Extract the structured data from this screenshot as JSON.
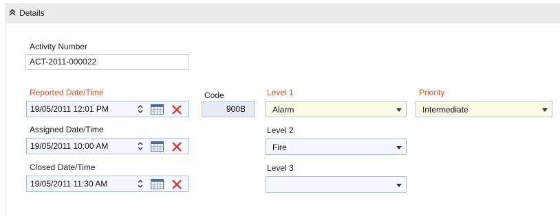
{
  "section": {
    "title": "Details",
    "collapse_icon": "double-chevron-up-icon"
  },
  "activity": {
    "label": "Activity Number",
    "value": "ACT-2011-000022"
  },
  "reported": {
    "label": "Reported Date/Time",
    "value": "19/05/2011 12:01 PM"
  },
  "assigned": {
    "label": "Assigned Date/Time",
    "value": "19/05/2011 10:00 AM"
  },
  "closed": {
    "label": "Closed Date/Time",
    "value": "19/05/2011 11:30 AM"
  },
  "code": {
    "label": "Code",
    "value": "900B"
  },
  "level1": {
    "label": "Level 1",
    "value": "Alarm"
  },
  "level2": {
    "label": "Level 2",
    "value": "Fire"
  },
  "level3": {
    "label": "Level 3",
    "value": ""
  },
  "priority": {
    "label": "Priority",
    "value": "Intermediate"
  },
  "icons": {
    "spin": "spinner-up-down-icon",
    "calendar": "calendar-icon",
    "clear": "clear-x-icon",
    "dropdown": "dropdown-arrow-icon"
  },
  "colors": {
    "required_label": "#e8502a",
    "field_border": "#a9bfd9",
    "field_bg": "#f4f7fd",
    "mandatory_field_bg": "#fcfbe6",
    "readonly_bg": "#e6edf7",
    "clear_icon": "#e0322a",
    "header_bg": "#ececec"
  }
}
